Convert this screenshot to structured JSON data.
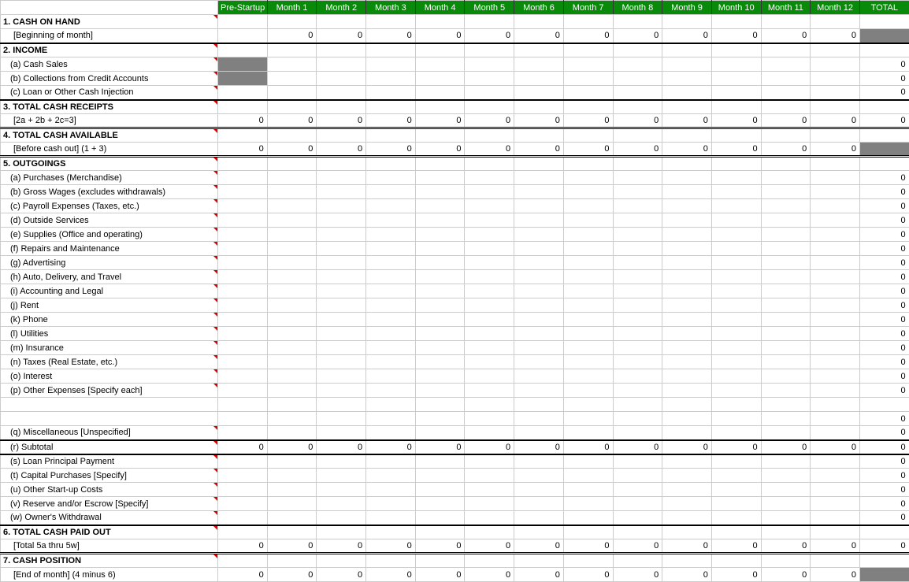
{
  "headers": [
    "Pre-Startup",
    "Month 1",
    "Month 2",
    "Month 3",
    "Month 4",
    "Month 5",
    "Month 6",
    "Month 7",
    "Month 8",
    "Month 9",
    "Month 10",
    "Month 11",
    "Month 12",
    "TOTAL"
  ],
  "rows": [
    {
      "label": "1. CASH ON HAND",
      "cls": "section",
      "marker": true,
      "vals": [
        "",
        "",
        "",
        "",
        "",
        "",
        "",
        "",
        "",
        "",
        "",
        "",
        "",
        ""
      ]
    },
    {
      "label": "[Beginning of month]",
      "cls": "sub",
      "vals": [
        "",
        "0",
        "0",
        "0",
        "0",
        "0",
        "0",
        "0",
        "0",
        "0",
        "0",
        "0",
        "0",
        ""
      ],
      "lastGray": true,
      "thickBottom": true
    },
    {
      "label": "2. INCOME",
      "cls": "section",
      "marker": true,
      "vals": [
        "",
        "",
        "",
        "",
        "",
        "",
        "",
        "",
        "",
        "",
        "",
        "",
        "",
        ""
      ]
    },
    {
      "label": "(a) Cash Sales",
      "cls": "sub2",
      "marker": true,
      "firstGray": true,
      "vals": [
        "",
        "",
        "",
        "",
        "",
        "",
        "",
        "",
        "",
        "",
        "",
        "",
        "",
        "0"
      ]
    },
    {
      "label": "(b) Collections from Credit Accounts",
      "cls": "sub2",
      "marker": true,
      "firstGray": true,
      "vals": [
        "",
        "",
        "",
        "",
        "",
        "",
        "",
        "",
        "",
        "",
        "",
        "",
        "",
        "0"
      ]
    },
    {
      "label": "(c) Loan or Other Cash Injection",
      "cls": "sub2",
      "marker": true,
      "vals": [
        "",
        "",
        "",
        "",
        "",
        "",
        "",
        "",
        "",
        "",
        "",
        "",
        "",
        "0"
      ],
      "thickBottom": true
    },
    {
      "label": "3. TOTAL CASH RECEIPTS",
      "cls": "section",
      "marker": true,
      "vals": [
        "",
        "",
        "",
        "",
        "",
        "",
        "",
        "",
        "",
        "",
        "",
        "",
        "",
        ""
      ]
    },
    {
      "label": "[2a + 2b + 2c=3]",
      "cls": "sub",
      "vals": [
        "0",
        "0",
        "0",
        "0",
        "0",
        "0",
        "0",
        "0",
        "0",
        "0",
        "0",
        "0",
        "0",
        "0"
      ],
      "dblBottom": true
    },
    {
      "label": "4. TOTAL CASH AVAILABLE",
      "cls": "section",
      "marker": true,
      "vals": [
        "",
        "",
        "",
        "",
        "",
        "",
        "",
        "",
        "",
        "",
        "",
        "",
        "",
        ""
      ]
    },
    {
      "label": "[Before cash out] (1 + 3)",
      "cls": "sub",
      "vals": [
        "0",
        "0",
        "0",
        "0",
        "0",
        "0",
        "0",
        "0",
        "0",
        "0",
        "0",
        "0",
        "0",
        ""
      ],
      "lastGray": true,
      "dblBottom": true
    },
    {
      "label": "5. OUTGOINGS",
      "cls": "section",
      "marker": true,
      "vals": [
        "",
        "",
        "",
        "",
        "",
        "",
        "",
        "",
        "",
        "",
        "",
        "",
        "",
        ""
      ]
    },
    {
      "label": "(a) Purchases (Merchandise)",
      "cls": "sub2",
      "marker": true,
      "vals": [
        "",
        "",
        "",
        "",
        "",
        "",
        "",
        "",
        "",
        "",
        "",
        "",
        "",
        "0"
      ]
    },
    {
      "label": "(b) Gross Wages (excludes withdrawals)",
      "cls": "sub2",
      "marker": true,
      "vals": [
        "",
        "",
        "",
        "",
        "",
        "",
        "",
        "",
        "",
        "",
        "",
        "",
        "",
        "0"
      ]
    },
    {
      "label": "(c) Payroll Expenses (Taxes, etc.)",
      "cls": "sub2",
      "marker": true,
      "vals": [
        "",
        "",
        "",
        "",
        "",
        "",
        "",
        "",
        "",
        "",
        "",
        "",
        "",
        "0"
      ]
    },
    {
      "label": "(d) Outside Services",
      "cls": "sub2",
      "marker": true,
      "vals": [
        "",
        "",
        "",
        "",
        "",
        "",
        "",
        "",
        "",
        "",
        "",
        "",
        "",
        "0"
      ]
    },
    {
      "label": "(e) Supplies (Office and operating)",
      "cls": "sub2",
      "marker": true,
      "vals": [
        "",
        "",
        "",
        "",
        "",
        "",
        "",
        "",
        "",
        "",
        "",
        "",
        "",
        "0"
      ]
    },
    {
      "label": "(f) Repairs and Maintenance",
      "cls": "sub2",
      "marker": true,
      "vals": [
        "",
        "",
        "",
        "",
        "",
        "",
        "",
        "",
        "",
        "",
        "",
        "",
        "",
        "0"
      ]
    },
    {
      "label": "(g) Advertising",
      "cls": "sub2",
      "marker": true,
      "vals": [
        "",
        "",
        "",
        "",
        "",
        "",
        "",
        "",
        "",
        "",
        "",
        "",
        "",
        "0"
      ]
    },
    {
      "label": "(h) Auto, Delivery, and Travel",
      "cls": "sub2",
      "marker": true,
      "vals": [
        "",
        "",
        "",
        "",
        "",
        "",
        "",
        "",
        "",
        "",
        "",
        "",
        "",
        "0"
      ]
    },
    {
      "label": "(i) Accounting and Legal",
      "cls": "sub2",
      "marker": true,
      "vals": [
        "",
        "",
        "",
        "",
        "",
        "",
        "",
        "",
        "",
        "",
        "",
        "",
        "",
        "0"
      ]
    },
    {
      "label": "(j) Rent",
      "cls": "sub2",
      "marker": true,
      "vals": [
        "",
        "",
        "",
        "",
        "",
        "",
        "",
        "",
        "",
        "",
        "",
        "",
        "",
        "0"
      ]
    },
    {
      "label": "(k) Phone",
      "cls": "sub2",
      "marker": true,
      "vals": [
        "",
        "",
        "",
        "",
        "",
        "",
        "",
        "",
        "",
        "",
        "",
        "",
        "",
        "0"
      ]
    },
    {
      "label": "(l) Utilities",
      "cls": "sub2",
      "marker": true,
      "vals": [
        "",
        "",
        "",
        "",
        "",
        "",
        "",
        "",
        "",
        "",
        "",
        "",
        "",
        "0"
      ]
    },
    {
      "label": "(m) Insurance",
      "cls": "sub2",
      "marker": true,
      "vals": [
        "",
        "",
        "",
        "",
        "",
        "",
        "",
        "",
        "",
        "",
        "",
        "",
        "",
        "0"
      ]
    },
    {
      "label": "(n) Taxes (Real Estate, etc.)",
      "cls": "sub2",
      "marker": true,
      "vals": [
        "",
        "",
        "",
        "",
        "",
        "",
        "",
        "",
        "",
        "",
        "",
        "",
        "",
        "0"
      ]
    },
    {
      "label": "(o) Interest",
      "cls": "sub2",
      "marker": true,
      "vals": [
        "",
        "",
        "",
        "",
        "",
        "",
        "",
        "",
        "",
        "",
        "",
        "",
        "",
        "0"
      ]
    },
    {
      "label": "(p) Other Expenses [Specify each]",
      "cls": "sub2",
      "marker": true,
      "vals": [
        "",
        "",
        "",
        "",
        "",
        "",
        "",
        "",
        "",
        "",
        "",
        "",
        "",
        "0"
      ]
    },
    {
      "label": "",
      "cls": "sub2",
      "vals": [
        "",
        "",
        "",
        "",
        "",
        "",
        "",
        "",
        "",
        "",
        "",
        "",
        "",
        ""
      ]
    },
    {
      "label": "",
      "cls": "sub2",
      "vals": [
        "",
        "",
        "",
        "",
        "",
        "",
        "",
        "",
        "",
        "",
        "",
        "",
        "",
        "0"
      ]
    },
    {
      "label": "(q) Miscellaneous [Unspecified]",
      "cls": "sub2",
      "marker": true,
      "vals": [
        "",
        "",
        "",
        "",
        "",
        "",
        "",
        "",
        "",
        "",
        "",
        "",
        "",
        "0"
      ],
      "thickBottom": true
    },
    {
      "label": "(r) Subtotal",
      "cls": "sub2",
      "marker": true,
      "vals": [
        "0",
        "0",
        "0",
        "0",
        "0",
        "0",
        "0",
        "0",
        "0",
        "0",
        "0",
        "0",
        "0",
        "0"
      ],
      "thickBottom": true
    },
    {
      "label": "(s) Loan Principal Payment",
      "cls": "sub2",
      "marker": true,
      "vals": [
        "",
        "",
        "",
        "",
        "",
        "",
        "",
        "",
        "",
        "",
        "",
        "",
        "",
        "0"
      ]
    },
    {
      "label": "(t) Capital Purchases [Specify]",
      "cls": "sub2",
      "marker": true,
      "vals": [
        "",
        "",
        "",
        "",
        "",
        "",
        "",
        "",
        "",
        "",
        "",
        "",
        "",
        "0"
      ]
    },
    {
      "label": "(u) Other Start-up Costs",
      "cls": "sub2",
      "marker": true,
      "vals": [
        "",
        "",
        "",
        "",
        "",
        "",
        "",
        "",
        "",
        "",
        "",
        "",
        "",
        "0"
      ]
    },
    {
      "label": "(v) Reserve and/or Escrow [Specify]",
      "cls": "sub2",
      "marker": true,
      "vals": [
        "",
        "",
        "",
        "",
        "",
        "",
        "",
        "",
        "",
        "",
        "",
        "",
        "",
        "0"
      ]
    },
    {
      "label": "(w) Owner's Withdrawal",
      "cls": "sub2",
      "marker": true,
      "vals": [
        "",
        "",
        "",
        "",
        "",
        "",
        "",
        "",
        "",
        "",
        "",
        "",
        "",
        "0"
      ],
      "thickBottom": true
    },
    {
      "label": "6. TOTAL CASH PAID OUT",
      "cls": "section",
      "marker": true,
      "vals": [
        "",
        "",
        "",
        "",
        "",
        "",
        "",
        "",
        "",
        "",
        "",
        "",
        "",
        ""
      ]
    },
    {
      "label": "[Total 5a thru 5w]",
      "cls": "sub",
      "vals": [
        "0",
        "0",
        "0",
        "0",
        "0",
        "0",
        "0",
        "0",
        "0",
        "0",
        "0",
        "0",
        "0",
        "0"
      ],
      "dblBottom": true
    },
    {
      "label": "7. CASH POSITION",
      "cls": "section",
      "marker": true,
      "vals": [
        "",
        "",
        "",
        "",
        "",
        "",
        "",
        "",
        "",
        "",
        "",
        "",
        "",
        ""
      ]
    },
    {
      "label": "[End of month]  (4 minus 6)",
      "cls": "sub",
      "vals": [
        "0",
        "0",
        "0",
        "0",
        "0",
        "0",
        "0",
        "0",
        "0",
        "0",
        "0",
        "0",
        "0",
        ""
      ],
      "lastGray": true
    }
  ]
}
